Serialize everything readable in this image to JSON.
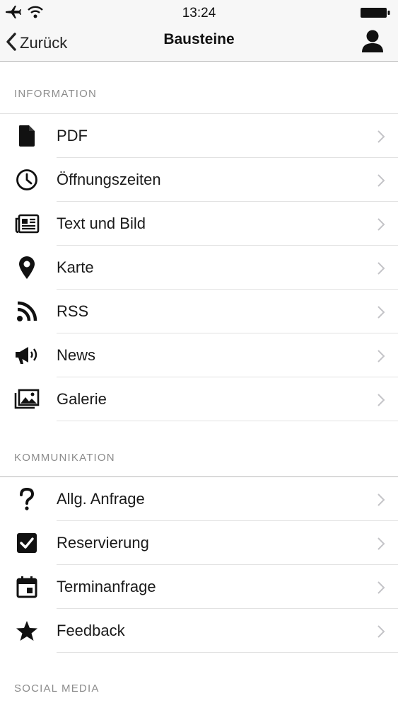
{
  "status_bar": {
    "time": "13:24",
    "icons": [
      "airplane-icon",
      "wifi-icon",
      "battery-icon"
    ]
  },
  "nav": {
    "back_label": "Zurück",
    "title": "Bausteine",
    "right_icon": "profile-icon"
  },
  "sections": [
    {
      "header": "INFORMATION",
      "items": [
        {
          "label": "PDF",
          "icon": "document-icon"
        },
        {
          "label": "Öffnungszeiten",
          "icon": "clock-icon"
        },
        {
          "label": "Text und Bild",
          "icon": "newspaper-icon"
        },
        {
          "label": "Karte",
          "icon": "map-pin-icon"
        },
        {
          "label": "RSS",
          "icon": "rss-icon"
        },
        {
          "label": "News",
          "icon": "megaphone-icon"
        },
        {
          "label": "Galerie",
          "icon": "gallery-icon"
        }
      ]
    },
    {
      "header": "KOMMUNIKATION",
      "items": [
        {
          "label": "Allg. Anfrage",
          "icon": "question-icon"
        },
        {
          "label": "Reservierung",
          "icon": "checkbox-icon"
        },
        {
          "label": "Terminanfrage",
          "icon": "calendar-icon"
        },
        {
          "label": "Feedback",
          "icon": "star-icon"
        }
      ]
    },
    {
      "header": "SOCIAL MEDIA",
      "items": []
    }
  ],
  "colors": {
    "bar_background": "#f7f7f7",
    "section_text": "#8c8c8c",
    "separator": "#e2e2e2",
    "chevron": "#c4c4c8"
  }
}
